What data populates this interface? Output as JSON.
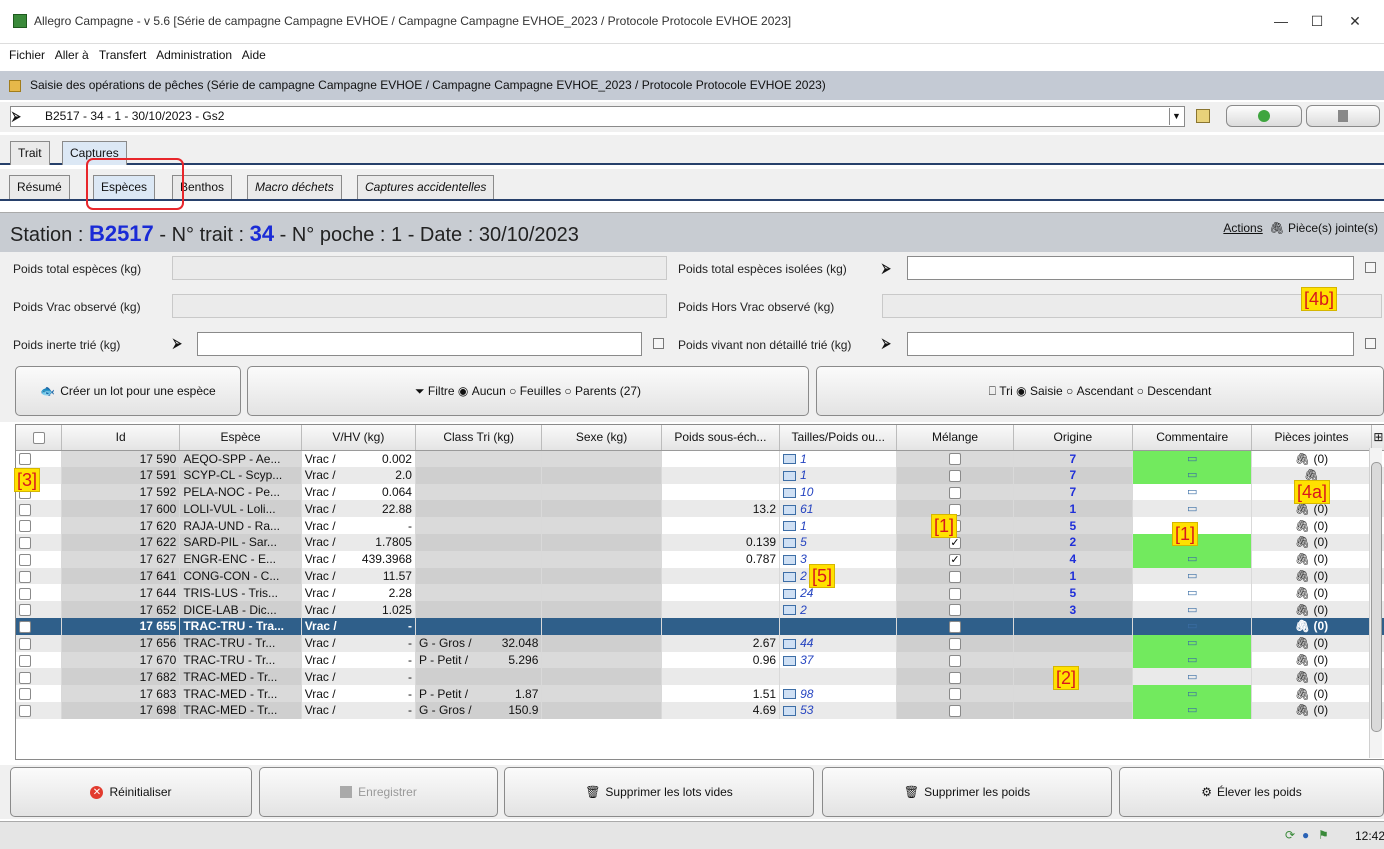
{
  "window": {
    "title": "Allegro Campagne - v 5.6 [Série de campagne Campagne EVHOE / Campagne Campagne EVHOE_2023 / Protocole Protocole EVHOE 2023]",
    "minimize": "—",
    "maximize": "☐",
    "close": "✕"
  },
  "menu": [
    "Fichier",
    "Aller à",
    "Transfert",
    "Administration",
    "Aide"
  ],
  "frame": {
    "title": "Saisie des opérations de pêches (Série de campagne Campagne EVHOE / Campagne Campagne EVHOE_2023 / Protocole Protocole EVHOE 2023)"
  },
  "selector": {
    "value": "B2517 - 34 - 1 - 30/10/2023 - Gs2"
  },
  "tabs_main": [
    "Trait",
    "Captures"
  ],
  "tabs_sub": [
    "Résumé",
    "Espèces",
    "Benthos",
    "Macro déchets",
    "Captures accidentelles"
  ],
  "station": {
    "prefix": "Station :",
    "code": "B2517",
    "trait_label": "- N° trait :",
    "trait": "34",
    "rest": "- N° poche : 1 - Date : 30/10/2023",
    "actions": "Actions",
    "attachments": "Pièce(s) jointe(s)"
  },
  "form": {
    "poids_total": "Poids total espèces (kg)",
    "poids_total_isolees": "Poids total espèces isolées (kg)",
    "poids_vrac": "Poids Vrac observé (kg)",
    "poids_hors_vrac": "Poids Hors Vrac observé (kg)",
    "poids_inerte": "Poids inerte trié (kg)",
    "poids_vivant": "Poids vivant non détaillé trié (kg)"
  },
  "toolbar": {
    "create_lot": "Créer un lot pour une espèce",
    "filter_label": "Filtre",
    "filter_options": [
      "Aucun",
      "Feuilles",
      "Parents (27)"
    ],
    "sort_label": "Tri",
    "sort_options": [
      "Saisie",
      "Ascendant",
      "Descendant"
    ]
  },
  "grid": {
    "headers": [
      "Id",
      "Espèce",
      "V/HV (kg)",
      "Class Tri (kg)",
      "Sexe (kg)",
      "Poids sous-éch...",
      "Tailles/Poids ou...",
      "Mélange",
      "Origine",
      "Commentaire",
      "Pièces jointes"
    ],
    "rows": [
      {
        "id": "17 590",
        "espece": "AEQO-SPP - Ae...",
        "vhv": "Vrac /",
        "vhv_val": "0.002",
        "class": "",
        "class_val": "",
        "sous": "",
        "tailles": "1",
        "mel": false,
        "orig": "7",
        "green": true,
        "pj": "(0)"
      },
      {
        "id": "17 591",
        "espece": "SCYP-CL - Scyp...",
        "vhv": "Vrac /",
        "vhv_val": "2.0",
        "class": "",
        "class_val": "",
        "sous": "",
        "tailles": "1",
        "mel": false,
        "orig": "7",
        "green": true,
        "pj": ""
      },
      {
        "id": "17 592",
        "espece": "PELA-NOC - Pe...",
        "vhv": "Vrac /",
        "vhv_val": "0.064",
        "class": "",
        "class_val": "",
        "sous": "",
        "tailles": "10",
        "mel": false,
        "orig": "7",
        "green": false,
        "pj": ""
      },
      {
        "id": "17 600",
        "espece": "LOLI-VUL - Loli...",
        "vhv": "Vrac /",
        "vhv_val": "22.88",
        "class": "",
        "class_val": "",
        "sous": "13.2",
        "tailles": "61",
        "mel": false,
        "orig": "1",
        "green": false,
        "pj": "(0)"
      },
      {
        "id": "17 620",
        "espece": "RAJA-UND - Ra...",
        "vhv": "Vrac /",
        "vhv_val": "-",
        "class": "",
        "class_val": "",
        "sous": "",
        "tailles": "1",
        "mel": false,
        "orig": "5",
        "green": false,
        "pj": "(0)"
      },
      {
        "id": "17 622",
        "espece": "SARD-PIL - Sar...",
        "vhv": "Vrac /",
        "vhv_val": "1.7805",
        "class": "",
        "class_val": "",
        "sous": "0.139",
        "tailles": "5",
        "mel": true,
        "orig": "2",
        "green": true,
        "pj": "(0)"
      },
      {
        "id": "17 627",
        "espece": "ENGR-ENC - E...",
        "vhv": "Vrac /",
        "vhv_val": "439.3968",
        "class": "",
        "class_val": "",
        "sous": "0.787",
        "tailles": "3",
        "mel": true,
        "orig": "4",
        "green": true,
        "pj": "(0)"
      },
      {
        "id": "17 641",
        "espece": "CONG-CON - C...",
        "vhv": "Vrac /",
        "vhv_val": "11.57",
        "class": "",
        "class_val": "",
        "sous": "",
        "tailles": "2",
        "mel": false,
        "orig": "1",
        "green": false,
        "pj": "(0)"
      },
      {
        "id": "17 644",
        "espece": "TRIS-LUS - Tris...",
        "vhv": "Vrac /",
        "vhv_val": "2.28",
        "class": "",
        "class_val": "",
        "sous": "",
        "tailles": "24",
        "mel": false,
        "orig": "5",
        "green": false,
        "pj": "(0)"
      },
      {
        "id": "17 652",
        "espece": "DICE-LAB - Dic...",
        "vhv": "Vrac /",
        "vhv_val": "1.025",
        "class": "",
        "class_val": "",
        "sous": "",
        "tailles": "2",
        "mel": false,
        "orig": "3",
        "green": false,
        "pj": "(0)"
      },
      {
        "id": "17 655",
        "espece": "TRAC-TRU - Tra...",
        "vhv": "Vrac /",
        "vhv_val": "-",
        "class": "",
        "class_val": "",
        "sous": "",
        "tailles": "",
        "mel": false,
        "orig": "",
        "green": false,
        "pj": "(0)",
        "sel": true
      },
      {
        "id": "17 656",
        "espece": "TRAC-TRU - Tr...",
        "vhv": "Vrac /",
        "vhv_val": "-",
        "class": "G - Gros /",
        "class_val": "32.048",
        "sous": "2.67",
        "tailles": "44",
        "mel": false,
        "orig": "",
        "green": true,
        "pj": "(0)"
      },
      {
        "id": "17 670",
        "espece": "TRAC-TRU - Tr...",
        "vhv": "Vrac /",
        "vhv_val": "-",
        "class": "P - Petit /",
        "class_val": "5.296",
        "sous": "0.96",
        "tailles": "37",
        "mel": false,
        "orig": "",
        "green": true,
        "pj": "(0)"
      },
      {
        "id": "17 682",
        "espece": "TRAC-MED - Tr...",
        "vhv": "Vrac /",
        "vhv_val": "-",
        "class": "",
        "class_val": "",
        "sous": "",
        "tailles": "",
        "mel": false,
        "orig": "",
        "green": false,
        "pj": "(0)"
      },
      {
        "id": "17 683",
        "espece": "TRAC-MED - Tr...",
        "vhv": "Vrac /",
        "vhv_val": "-",
        "class": "P - Petit /",
        "class_val": "1.87",
        "sous": "1.51",
        "tailles": "98",
        "mel": false,
        "orig": "",
        "green": true,
        "pj": "(0)"
      },
      {
        "id": "17 698",
        "espece": "TRAC-MED - Tr...",
        "vhv": "Vrac /",
        "vhv_val": "-",
        "class": "G - Gros /",
        "class_val": "150.9",
        "sous": "4.69",
        "tailles": "53",
        "mel": false,
        "orig": "",
        "green": true,
        "pj": "(0)"
      }
    ]
  },
  "annotations": {
    "a1": "[1]",
    "a1b": "[1]",
    "a2": "[2]",
    "a3": "[3]",
    "a4a": "[4a]",
    "a4b": "[4b]",
    "a5": "[5]"
  },
  "bottom": {
    "reset": "Réinitialiser",
    "save": "Enregistrer",
    "delete_empty": "Supprimer les lots vides",
    "delete_weights": "Supprimer les poids",
    "raise_weights": "Élever les poids"
  },
  "status": {
    "time": "12:42"
  }
}
